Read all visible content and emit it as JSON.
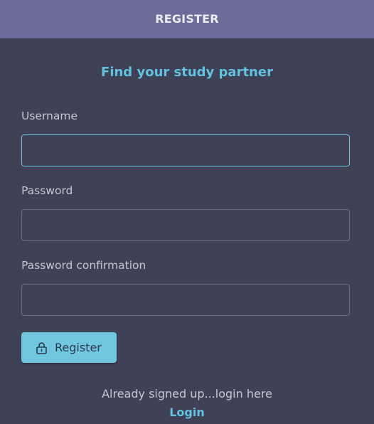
{
  "header": {
    "title": "REGISTER"
  },
  "subtitle": "Find your study partner",
  "form": {
    "username": {
      "label": "Username",
      "value": "",
      "placeholder": ""
    },
    "password": {
      "label": "Password",
      "value": "",
      "placeholder": ""
    },
    "password_confirmation": {
      "label": "Password confirmation",
      "value": "",
      "placeholder": ""
    },
    "submit": {
      "label": "Register",
      "icon": "lock-icon"
    }
  },
  "footer": {
    "text": "Already signed up...login here",
    "link_label": "Login"
  },
  "colors": {
    "header_bg": "#6b6c99",
    "card_bg": "#3f4156",
    "accent": "#63c2df",
    "button_bg": "#71c7e0"
  }
}
